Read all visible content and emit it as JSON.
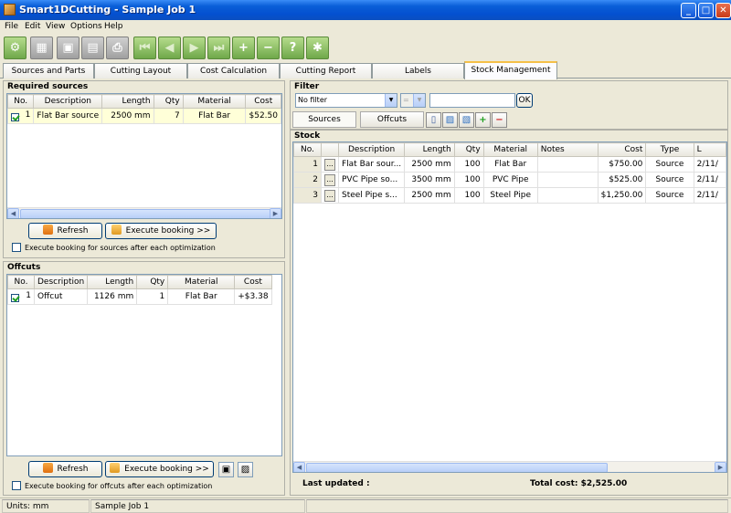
{
  "window": {
    "title": "Smart1DCutting - Sample Job 1"
  },
  "menu": [
    "File",
    "Edit",
    "View",
    "Options",
    "Help"
  ],
  "tabs": [
    "Sources and Parts",
    "Cutting Layout",
    "Cost Calculation",
    "Cutting Report",
    "Labels",
    "Stock Management"
  ],
  "required_sources": {
    "title": "Required sources",
    "columns": [
      "No.",
      "Description",
      "Length",
      "Qty",
      "Material",
      "Cost"
    ],
    "rows": [
      {
        "no": "1",
        "description": "Flat Bar source",
        "length": "2500 mm",
        "qty": "7",
        "material": "Flat Bar",
        "cost": "$52.50"
      }
    ],
    "refresh_label": "Refresh",
    "execute_label": "Execute booking  >>",
    "auto_label": "Execute booking for sources after each optimization"
  },
  "offcuts": {
    "title": "Offcuts",
    "columns": [
      "No.",
      "Description",
      "Length",
      "Qty",
      "Material",
      "Cost"
    ],
    "rows": [
      {
        "no": "1",
        "description": "Offcut",
        "length": "1126 mm",
        "qty": "1",
        "material": "Flat Bar",
        "cost": "+$3.38"
      }
    ],
    "refresh_label": "Refresh",
    "execute_label": "Execute booking  >>",
    "auto_label": "Execute booking for offcuts after each optimization"
  },
  "filter": {
    "title": "Filter",
    "selected": "No filter",
    "operator": "=",
    "value": "",
    "ok_label": "OK",
    "subtabs": [
      "Sources",
      "Offcuts"
    ]
  },
  "stock": {
    "title": "Stock",
    "columns": [
      "No.",
      "",
      "Description",
      "Length",
      "Qty",
      "Material",
      "Notes",
      "Cost",
      "Type",
      "L"
    ],
    "rows": [
      {
        "no": "1",
        "description": "Flat Bar sour...",
        "length": "2500 mm",
        "qty": "100",
        "material": "Flat Bar",
        "notes": "",
        "cost": "$750.00",
        "type": "Source",
        "date": "2/11/"
      },
      {
        "no": "2",
        "description": "PVC Pipe so...",
        "length": "3500 mm",
        "qty": "100",
        "material": "PVC Pipe",
        "notes": "",
        "cost": "$525.00",
        "type": "Source",
        "date": "2/11/"
      },
      {
        "no": "3",
        "description": "Steel Pipe s...",
        "length": "2500 mm",
        "qty": "100",
        "material": "Steel Pipe",
        "notes": "",
        "cost": "$1,250.00",
        "type": "Source",
        "date": "2/11/"
      }
    ],
    "last_updated_label": "Last updated :",
    "total_cost_label": "Total cost: $2,525.00"
  },
  "status": {
    "units": "Units: mm",
    "job": "Sample Job 1"
  }
}
